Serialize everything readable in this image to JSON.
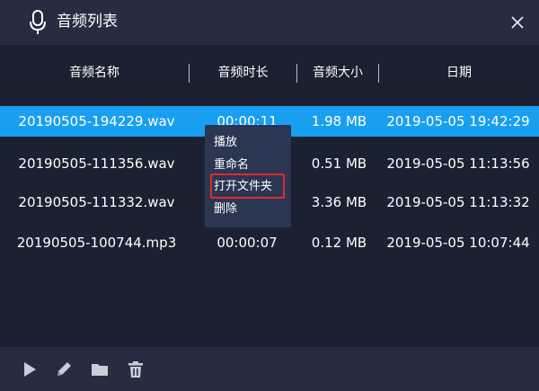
{
  "window": {
    "title": "音频列表"
  },
  "table": {
    "headers": [
      "音频名称",
      "音频时长",
      "音频大小",
      "日期"
    ],
    "rows": [
      {
        "name": "20190505-194229.wav",
        "duration": "00:00:11",
        "size": "1.98 MB",
        "date": "2019-05-05 19:42:29"
      },
      {
        "name": "20190505-111356.wav",
        "duration": "",
        "size": "0.51 MB",
        "date": "2019-05-05 11:13:56"
      },
      {
        "name": "20190505-111332.wav",
        "duration": "",
        "size": "3.36 MB",
        "date": "2019-05-05 11:13:32"
      },
      {
        "name": "20190505-100744.mp3",
        "duration": "00:00:07",
        "size": "0.12 MB",
        "date": "2019-05-05 10:07:44"
      }
    ]
  },
  "context_menu": {
    "items": [
      {
        "label": "播放"
      },
      {
        "label": "重命名"
      },
      {
        "label": "打开文件夹",
        "highlighted": true
      },
      {
        "label": "删除"
      }
    ]
  },
  "footer": {
    "buttons": [
      {
        "icon": "play-icon"
      },
      {
        "icon": "pencil-icon"
      },
      {
        "icon": "folder-icon"
      },
      {
        "icon": "trash-icon"
      }
    ]
  },
  "colors": {
    "background": "#1b2130",
    "bar": "#262d40",
    "selected_row": "#199ff0",
    "menu": "#2b3653",
    "highlight_border": "#e02a2a",
    "footer_icon": "#c9ced8"
  }
}
